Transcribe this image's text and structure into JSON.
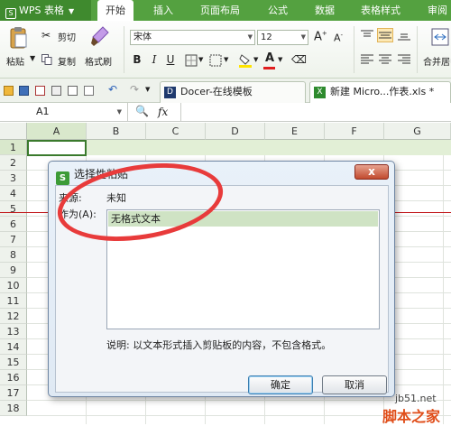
{
  "menubar": {
    "app_label": "WPS 表格",
    "tabs": [
      "开始",
      "插入",
      "页面布局",
      "公式",
      "数据",
      "表格样式",
      "审阅"
    ]
  },
  "ribbon": {
    "paste": "粘贴",
    "cut": "剪切",
    "copy": "复制",
    "format_painter": "格式刷",
    "font_name": "宋体",
    "font_size": "12",
    "bold": "B",
    "italic": "I",
    "underline": "U",
    "merge_center": "合并居中",
    "font_color": "#e01f1f",
    "highlight_color": "#ffe400"
  },
  "doc_tabs": [
    "Docer-在线模板",
    "新建 Micro...作表.xls *"
  ],
  "formula_bar": {
    "cell_ref": "A1",
    "fx": "fx"
  },
  "columns": [
    "A",
    "B",
    "C",
    "D",
    "E",
    "F",
    "G"
  ],
  "rows": [
    "1",
    "2",
    "3",
    "4",
    "5",
    "6",
    "7",
    "8",
    "9",
    "10",
    "11",
    "12",
    "13",
    "14",
    "15",
    "16",
    "17",
    "18"
  ],
  "dialog": {
    "title": "选择性粘贴",
    "close_label": "x",
    "source_label": "来源:",
    "source_value": "未知",
    "as_label": "作为(A):",
    "options": [
      "无格式文本"
    ],
    "description": "说明: 以文本形式插入剪贴板的内容，不包含格式。",
    "ok_label": "确定",
    "cancel_label": "取消"
  },
  "watermark": {
    "line1": "jb51.net",
    "line2": "脚本之家"
  }
}
